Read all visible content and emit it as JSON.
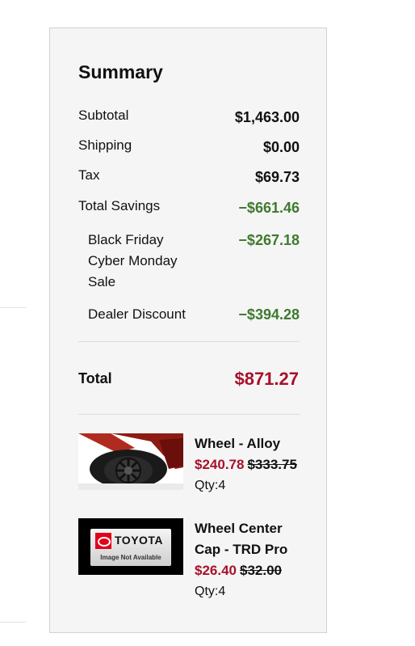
{
  "summary": {
    "title": "Summary",
    "rows": [
      {
        "label": "Subtotal",
        "value": "$1,463.00"
      },
      {
        "label": "Shipping",
        "value": "$0.00"
      },
      {
        "label": "Tax",
        "value": "$69.73"
      },
      {
        "label": "Total Savings",
        "value": "−$661.46"
      }
    ],
    "savings": [
      {
        "label": "Black Friday Cyber Monday Sale",
        "value": "−$267.18"
      },
      {
        "label": "Dealer Discount",
        "value": "−$394.28"
      }
    ],
    "total_label": "Total",
    "total_value": "$871.27"
  },
  "items": [
    {
      "name": "Wheel - Alloy",
      "price": "$240.78",
      "original_price": "$333.75",
      "qty": "Qty:4",
      "image_alt": "wheel-alloy-photo"
    },
    {
      "name": "Wheel Center Cap - TRD Pro",
      "price": "$26.40",
      "original_price": "$32.00",
      "qty": "Qty:4",
      "image_alt": "image-not-available",
      "placeholder": {
        "brand": "TOYOTA",
        "caption": "Image Not Available"
      }
    }
  ],
  "colors": {
    "accent_red": "#a7112b",
    "savings_green": "#3f7a2d",
    "panel_bg": "#f5f5f5"
  }
}
